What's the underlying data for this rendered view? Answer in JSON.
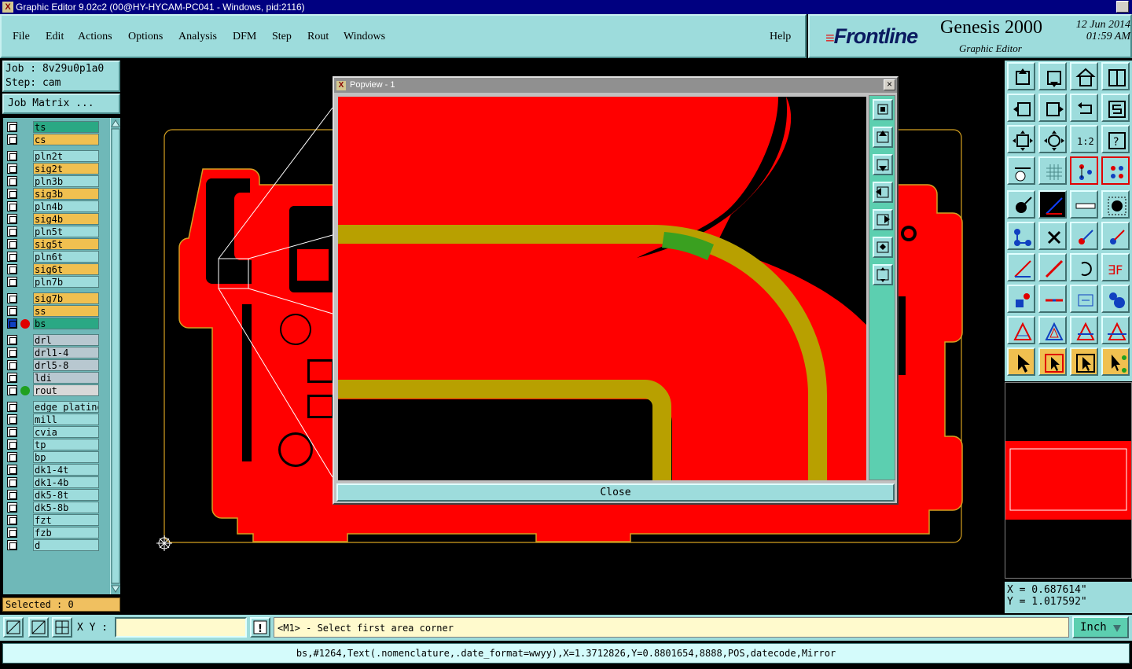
{
  "window": {
    "title": "Graphic Editor 9.02c2 (00@HY-HYCAM-PC041 - Windows, pid:2116)"
  },
  "menu": [
    "File",
    "Edit",
    "Actions",
    "Options",
    "Analysis",
    "DFM",
    "Step",
    "Rout",
    "Windows"
  ],
  "menu_help": "Help",
  "brand": {
    "logo": "Frontline",
    "product": "Genesis 2000",
    "subtitle": "Graphic Editor",
    "date": "12 Jun 2014",
    "time": "01:59 AM"
  },
  "job": {
    "job_label": "Job : 8v29u0p1a0",
    "step_label": "Step: cam",
    "matrix_button": "Job Matrix ..."
  },
  "layers": [
    {
      "name": "ts",
      "color": "#2aa884",
      "dot": ""
    },
    {
      "name": "cs",
      "color": "#f0c050",
      "dot": ""
    },
    {
      "name": "pln2t",
      "color": "#9ddcdc",
      "dot": ""
    },
    {
      "name": "sig2t",
      "color": "#f0c050",
      "dot": ""
    },
    {
      "name": "pln3b",
      "color": "#9ddcdc",
      "dot": ""
    },
    {
      "name": "sig3b",
      "color": "#f0c050",
      "dot": ""
    },
    {
      "name": "pln4b",
      "color": "#9ddcdc",
      "dot": ""
    },
    {
      "name": "sig4b",
      "color": "#f0c050",
      "dot": ""
    },
    {
      "name": "pln5t",
      "color": "#9ddcdc",
      "dot": ""
    },
    {
      "name": "sig5t",
      "color": "#f0c050",
      "dot": ""
    },
    {
      "name": "pln6t",
      "color": "#9ddcdc",
      "dot": ""
    },
    {
      "name": "sig6t",
      "color": "#f0c050",
      "dot": ""
    },
    {
      "name": "pln7b",
      "color": "#9ddcdc",
      "dot": ""
    },
    {
      "name": "sig7b",
      "color": "#f0c050",
      "dot": ""
    },
    {
      "name": "ss",
      "color": "#f0c050",
      "dot": ""
    },
    {
      "name": "bs",
      "color": "#2aa884",
      "dot": "#e00000",
      "selected": true
    },
    {
      "name": "drl",
      "color": "#b8c8d0",
      "dot": ""
    },
    {
      "name": "drl1-4",
      "color": "#b8c8d0",
      "dot": ""
    },
    {
      "name": "drl5-8",
      "color": "#b8c8d0",
      "dot": ""
    },
    {
      "name": "ldi",
      "color": "#b8c8d0",
      "dot": ""
    },
    {
      "name": "rout",
      "color": "#d8d8d8",
      "dot": "#20a020"
    },
    {
      "name": "edge_plating",
      "color": "#9ddcdc",
      "dot": ""
    },
    {
      "name": "mill",
      "color": "#9ddcdc",
      "dot": ""
    },
    {
      "name": "cvia",
      "color": "#9ddcdc",
      "dot": ""
    },
    {
      "name": "tp",
      "color": "#9ddcdc",
      "dot": ""
    },
    {
      "name": "bp",
      "color": "#9ddcdc",
      "dot": ""
    },
    {
      "name": "dk1-4t",
      "color": "#9ddcdc",
      "dot": ""
    },
    {
      "name": "dk1-4b",
      "color": "#9ddcdc",
      "dot": ""
    },
    {
      "name": "dk5-8t",
      "color": "#9ddcdc",
      "dot": ""
    },
    {
      "name": "dk5-8b",
      "color": "#9ddcdc",
      "dot": ""
    },
    {
      "name": "fzt",
      "color": "#9ddcdc",
      "dot": ""
    },
    {
      "name": "fzb",
      "color": "#9ddcdc",
      "dot": ""
    },
    {
      "name": "d",
      "color": "#9ddcdc",
      "dot": ""
    }
  ],
  "selected_count": "Selected : 0",
  "popview": {
    "title": "Popview - 1",
    "close_label": "Close"
  },
  "coords": {
    "x": "X = 0.687614\"",
    "y": "Y = 1.017592\""
  },
  "bottom": {
    "xy_label": "X Y :",
    "xy_value": "",
    "message": "<M1> - Select first area corner",
    "unit": "Inch"
  },
  "status": "bs,#1264,Text(.nomenclature,.date_format=wwyy),X=1.3712826,Y=0.8801654,8888,POS,datecode,Mirror",
  "colors": {
    "copper": "#ff0000",
    "trace": "#b8a000",
    "outline": "#d4a020",
    "panel": "#9ddcdc"
  }
}
